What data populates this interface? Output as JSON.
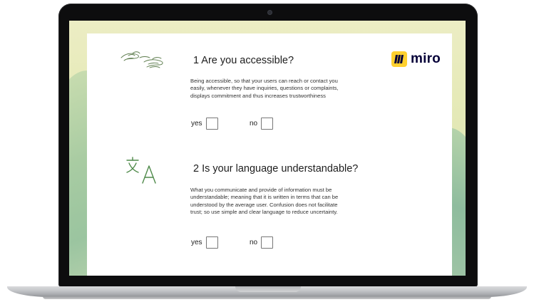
{
  "brand": {
    "logo_text": "miro",
    "accent_color": "#ffd02f"
  },
  "questions": [
    {
      "title": "1 Are you accessible?",
      "icon": "hands-icon",
      "description": "Being accessible, so that your users can reach or contact you easily, whenever they have inquiries, questions or complaints, displays commitment and thus increases trustworthiness",
      "yes_label": "yes",
      "no_label": "no"
    },
    {
      "title": "2 Is your language understandable?",
      "icon": "translate-icon",
      "description": "What you communicate and provide of information must be understandable; meaning that it is written in terms that can be understood by the average user. Confusion does not facilitate trust; so use simple and clear language to reduce uncertainty.",
      "yes_label": "yes",
      "no_label": "no"
    }
  ]
}
